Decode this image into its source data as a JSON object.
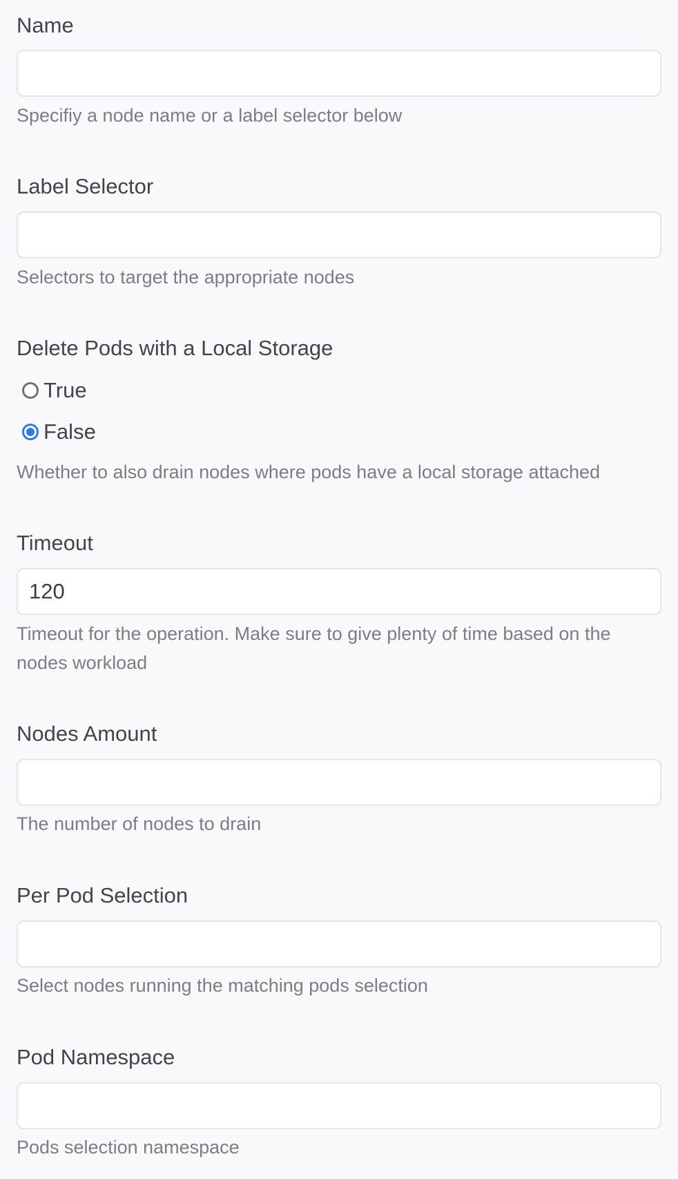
{
  "fields": {
    "name": {
      "label": "Name",
      "value": "",
      "help": "Specifiy a node name or a label selector below"
    },
    "label_selector": {
      "label": "Label Selector",
      "value": "",
      "help": "Selectors to target the appropriate nodes"
    },
    "delete_local_storage": {
      "label": "Delete Pods with a Local Storage",
      "options": [
        {
          "label": "True",
          "checked": false
        },
        {
          "label": "False",
          "checked": true
        }
      ],
      "help": "Whether to also drain nodes where pods have a local storage attached"
    },
    "timeout": {
      "label": "Timeout",
      "value": "120",
      "help": "Timeout for the operation. Make sure to give plenty of time based on the nodes workload"
    },
    "nodes_amount": {
      "label": "Nodes Amount",
      "value": "",
      "help": "The number of nodes to drain"
    },
    "per_pod_selection": {
      "label": "Per Pod Selection",
      "value": "",
      "help": "Select nodes running the matching pods selection"
    },
    "pod_namespace": {
      "label": "Pod Namespace",
      "value": "",
      "help": "Pods selection namespace"
    }
  },
  "colors": {
    "background": "#f8f9fb",
    "accent": "#2f7ae5",
    "help_text": "#7a7e84",
    "input_border": "#e3e5e9"
  }
}
